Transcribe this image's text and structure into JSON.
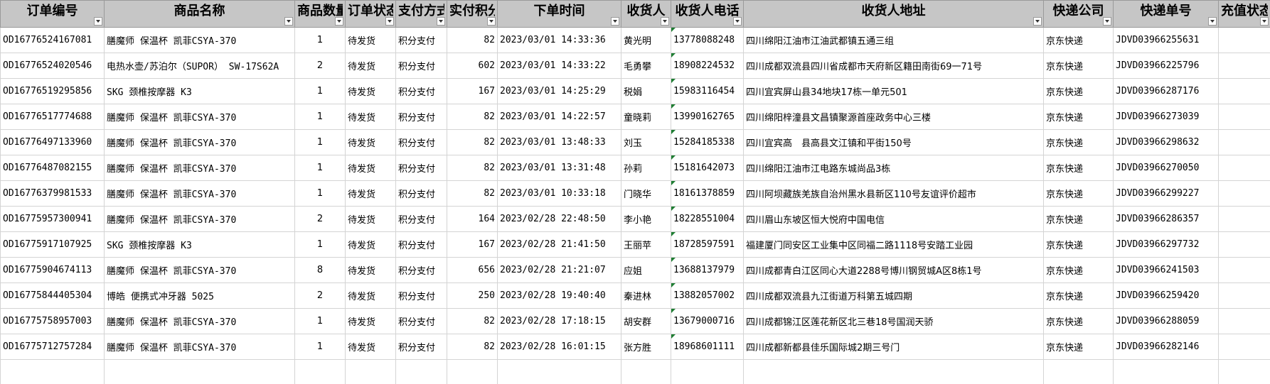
{
  "headers": [
    "订单编号",
    "商品名称",
    "商品数量",
    "订单状态",
    "支付方式",
    "实付积分",
    "下单时间",
    "收货人",
    "收货人电话",
    "收货人地址",
    "快递公司",
    "快递单号",
    "充值状态"
  ],
  "rows": [
    [
      "OD16776524167081",
      "膳魔师 保温杯 凯菲CSYA-370",
      "1",
      "待发货",
      "积分支付",
      "82",
      "2023/03/01 14:33:36",
      "黄光明",
      "13778088248",
      "四川绵阳江油市江油武都镇五通三组",
      "京东快递",
      "JDVD03966255631",
      ""
    ],
    [
      "OD16776524020546",
      "电热水壶/苏泊尔（SUPOR） SW-17S62A",
      "2",
      "待发货",
      "积分支付",
      "602",
      "2023/03/01 14:33:22",
      "毛勇攀",
      "18908224532",
      "四川成都双流县四川省成都市天府新区籍田南街69一71号",
      "京东快递",
      "JDVD03966225796",
      ""
    ],
    [
      "OD16776519295856",
      "SKG 颈椎按摩器 K3",
      "1",
      "待发货",
      "积分支付",
      "167",
      "2023/03/01 14:25:29",
      "税娟",
      "15983116454",
      "四川宜宾屏山县34地块17栋一单元501",
      "京东快递",
      "JDVD03966287176",
      ""
    ],
    [
      "OD16776517774688",
      "膳魔师 保温杯 凯菲CSYA-370",
      "1",
      "待发货",
      "积分支付",
      "82",
      "2023/03/01 14:22:57",
      "童晓莉",
      "13990162765",
      "四川绵阳梓潼县文昌镇聚源首座政务中心三楼",
      "京东快递",
      "JDVD03966273039",
      ""
    ],
    [
      "OD16776497133960",
      "膳魔师 保温杯 凯菲CSYA-370",
      "1",
      "待发货",
      "积分支付",
      "82",
      "2023/03/01 13:48:33",
      "刘玉",
      "15284185338",
      "四川宜宾高　县高县文江镇和平街150号",
      "京东快递",
      "JDVD03966298632",
      ""
    ],
    [
      "OD16776487082155",
      "膳魔师 保温杯 凯菲CSYA-370",
      "1",
      "待发货",
      "积分支付",
      "82",
      "2023/03/01 13:31:48",
      "孙莉",
      "15181642073",
      "四川绵阳江油市江电路东城尚品3栋",
      "京东快递",
      "JDVD03966270050",
      ""
    ],
    [
      "OD16776379981533",
      "膳魔师 保温杯 凯菲CSYA-370",
      "1",
      "待发货",
      "积分支付",
      "82",
      "2023/03/01 10:33:18",
      "门晓华",
      "18161378859",
      "四川阿坝藏族羌族自治州黑水县新区110号友谊评价超市",
      "京东快递",
      "JDVD03966299227",
      ""
    ],
    [
      "OD16775957300941",
      "膳魔师 保温杯 凯菲CSYA-370",
      "2",
      "待发货",
      "积分支付",
      "164",
      "2023/02/28 22:48:50",
      "李小艳",
      "18228551004",
      "四川眉山东坡区恒大悦府中国电信",
      "京东快递",
      "JDVD03966286357",
      ""
    ],
    [
      "OD16775917107925",
      "SKG 颈椎按摩器 K3",
      "1",
      "待发货",
      "积分支付",
      "167",
      "2023/02/28 21:41:50",
      "王丽苹",
      "18728597591",
      "福建厦门同安区工业集中区同福二路1118号安踏工业园",
      "京东快递",
      "JDVD03966297732",
      ""
    ],
    [
      "OD16775904674113",
      "膳魔师 保温杯 凯菲CSYA-370",
      "8",
      "待发货",
      "积分支付",
      "656",
      "2023/02/28 21:21:07",
      "应姐",
      "13688137979",
      "四川成都青白江区同心大道2288号博川钢贸城A区8栋1号",
      "京东快递",
      "JDVD03966241503",
      ""
    ],
    [
      "OD16775844405304",
      "博皓 便携式冲牙器 5025",
      "2",
      "待发货",
      "积分支付",
      "250",
      "2023/02/28 19:40:40",
      "秦进林",
      "13882057002",
      "四川成都双流县九江街道万科第五城四期",
      "京东快递",
      "JDVD03966259420",
      ""
    ],
    [
      "OD16775758957003",
      "膳魔师 保温杯 凯菲CSYA-370",
      "1",
      "待发货",
      "积分支付",
      "82",
      "2023/02/28 17:18:15",
      "胡安群",
      "13679000716",
      "四川成都锦江区莲花新区北三巷18号国润天骄",
      "京东快递",
      "JDVD03966288059",
      ""
    ],
    [
      "OD16775712757284",
      "膳魔师 保温杯 凯菲CSYA-370",
      "1",
      "待发货",
      "积分支付",
      "82",
      "2023/02/28 16:01:15",
      "张方胜",
      "18968601111",
      "四川成都新都县佳乐国际城2期三号门",
      "京东快递",
      "JDVD03966282146",
      ""
    ]
  ],
  "colors": {
    "header_bg": "#c6c6c6",
    "grid": "#d4d4d4",
    "text_marker": "#1e7d32"
  }
}
